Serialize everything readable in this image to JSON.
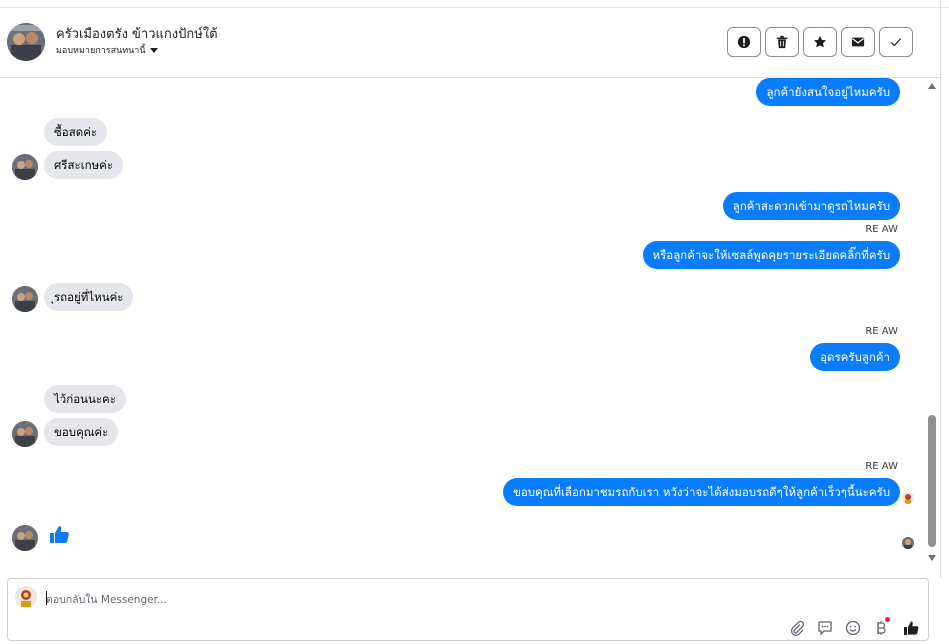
{
  "header": {
    "title": "ครัวเมืองตรัง ข้าวแกงปักษ์ใต้",
    "subtitle": "มอบหมายการสนทนานี้"
  },
  "header_actions": [
    {
      "icon": "alert-icon",
      "label": ""
    },
    {
      "icon": "trash-icon",
      "label": ""
    },
    {
      "icon": "star-icon",
      "label": ""
    },
    {
      "icon": "envelope-icon",
      "label": ""
    },
    {
      "icon": "check-icon",
      "label": ""
    }
  ],
  "messages": {
    "m1": "ลูกค้ายังสนใจอยู่ไหมครับ",
    "m2": "ซื้อสดค่ะ",
    "m3": "ศรีสะเกษค่ะ",
    "m4": "ลูกค้าสะดวกเข้ามาดูรถไหมครับ",
    "m4_sender": "RE AW",
    "m5": "หรือลูกค้าจะให้เซลล์พูดคุยรายระเอียดคลิ๊กที่ครับ",
    "m6": "ุรถอยู่ที่ไหนค่ะ",
    "m7_sender": "RE AW",
    "m7": "อุดรครับลูกค้า",
    "m8": "ไว้ก่อนนะคะ",
    "m9": "ขอบคุณค่ะ",
    "m10_sender": "RE AW",
    "m10": "ขอบคุณที่เลือกมาชมรถกับเรา หวังว่าจะได้ส่งมอบรถดีๆให้ลูกค้าเร็วๆนี้นะครับ"
  },
  "composer": {
    "placeholder": "ตอบกลับใน Messenger..."
  },
  "colors": {
    "outgoing": "#0a7cff",
    "incoming": "#e4e6eb"
  }
}
